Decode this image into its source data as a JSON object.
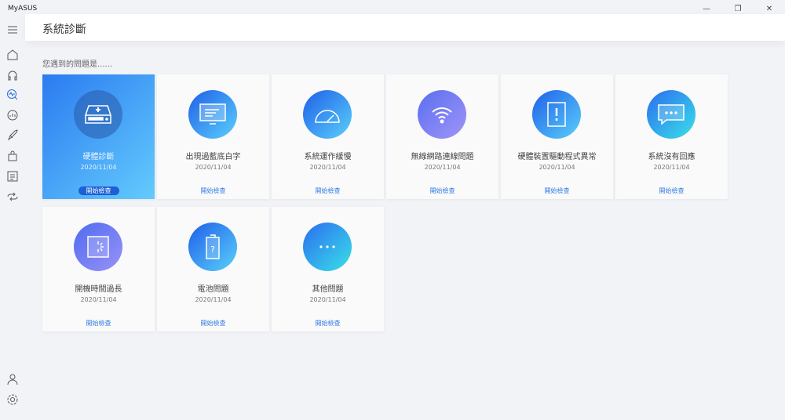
{
  "app": {
    "name": "MyASUS"
  },
  "header": {
    "title": "系統診斷"
  },
  "question": "您遇到的問題是......",
  "cards": [
    {
      "title": "硬體診斷",
      "date": "2020/11/04",
      "button": "開始檢查",
      "icon": "hard-drive-icon",
      "active": true,
      "grad": [
        "#2a7ef2",
        "#2a7ef2"
      ]
    },
    {
      "title": "出現過藍底白字",
      "date": "2020/11/04",
      "button": "開始檢查",
      "icon": "monitor-icon",
      "grad": [
        "#1f5fe8",
        "#5ad0fb"
      ]
    },
    {
      "title": "系統運作緩慢",
      "date": "2020/11/04",
      "button": "開始檢查",
      "icon": "speedometer-icon",
      "grad": [
        "#1f5fe8",
        "#5ad0fb"
      ]
    },
    {
      "title": "無線網路連線問題",
      "date": "2020/11/04",
      "button": "開始檢查",
      "icon": "wifi-icon",
      "grad": [
        "#5a6ef0",
        "#a095f7"
      ]
    },
    {
      "title": "硬體裝置驅動程式異常",
      "date": "2020/11/04",
      "button": "開始檢查",
      "icon": "chip-warning-icon",
      "grad": [
        "#1f5fe8",
        "#5ad0fb"
      ]
    },
    {
      "title": "系統沒有回應",
      "date": "2020/11/04",
      "button": "開始檢查",
      "icon": "message-icon",
      "grad": [
        "#2a6ef0",
        "#3ae0e8"
      ]
    },
    {
      "title": "開機時間過長",
      "date": "2020/11/04",
      "button": "開始檢查",
      "icon": "loading-screen-icon",
      "grad": [
        "#4e6cf0",
        "#9a92f7"
      ]
    },
    {
      "title": "電池問題",
      "date": "2020/11/04",
      "button": "開始檢查",
      "icon": "battery-icon",
      "grad": [
        "#1f5fe8",
        "#5ad0fb"
      ]
    },
    {
      "title": "其他問題",
      "date": "",
      "button": "開始檢查",
      "icon": "more-icon",
      "grad": [
        "#2a6ef0",
        "#3ae0e8"
      ]
    }
  ]
}
